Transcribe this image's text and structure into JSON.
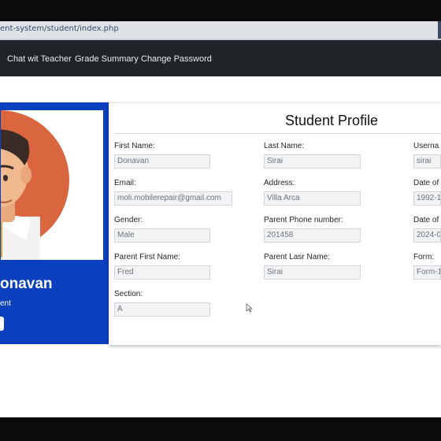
{
  "browser": {
    "url": "ent-system/student/index.php"
  },
  "nav": {
    "items": [
      "Chat wit Teacher",
      "Grade Summary",
      "Change Password"
    ]
  },
  "sidebar": {
    "name": "onavan",
    "role": "ent"
  },
  "profile": {
    "title": "Student Profile",
    "fields": [
      {
        "label": "First Name:",
        "value": "Donavan"
      },
      {
        "label": "Last Name:",
        "value": "Sirai"
      },
      {
        "label": "Userna",
        "value": "sirai"
      },
      {
        "label": "Email:",
        "value": "moli.mobilerepair@gmail.com"
      },
      {
        "label": "Address:",
        "value": "Villa Arca"
      },
      {
        "label": "Date of",
        "value": "1992-1"
      },
      {
        "label": "Gender:",
        "value": "Male"
      },
      {
        "label": "Parent Phone number:",
        "value": "201458"
      },
      {
        "label": "Date of",
        "value": "2024-0"
      },
      {
        "label": "Parent First Name:",
        "value": "Fred"
      },
      {
        "label": "Parent Lasr Name:",
        "value": "Sirai"
      },
      {
        "label": "Form:",
        "value": "Form-1"
      },
      {
        "label": "Section:",
        "value": "A"
      }
    ]
  },
  "colors": {
    "navbar": "#1f2429",
    "sidebar": "#0a3fbd",
    "avatar_bg": "#d9663f"
  }
}
